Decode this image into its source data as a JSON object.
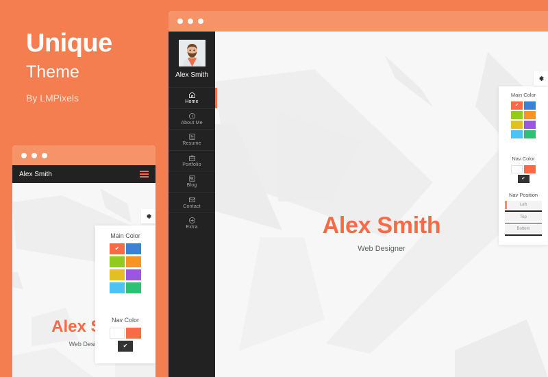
{
  "promo": {
    "title": "Unique",
    "subtitle": "Theme",
    "byline": "By LMPixels"
  },
  "colors": {
    "page_background": "#f47e4f",
    "window_bar": "#f79368",
    "sidebar": "#222222",
    "content_background": "#f7f7f7",
    "accent": "#fa6a47",
    "active_indicator": "#f4714e",
    "hero_name": "#fa6a47",
    "hero_role": "#5a5f63"
  },
  "desktop_window": {
    "titlebar_dots": 3,
    "sidebar": {
      "profile_name": "Alex Smith",
      "avatar_alt": "avatar",
      "items": [
        {
          "label": "Home",
          "icon": "home-icon",
          "active": true
        },
        {
          "label": "About Me",
          "icon": "info-icon",
          "active": false
        },
        {
          "label": "Resume",
          "icon": "resume-icon",
          "active": false
        },
        {
          "label": "Portfolio",
          "icon": "briefcase-icon",
          "active": false
        },
        {
          "label": "Blog",
          "icon": "blog-icon",
          "active": false
        },
        {
          "label": "Contact",
          "icon": "envelope-icon",
          "active": false
        },
        {
          "label": "Extra",
          "icon": "plus-icon",
          "active": false
        }
      ]
    },
    "hero": {
      "name": "Alex Smith",
      "role": "Web Designer"
    },
    "gear_button": {
      "icon": "gear-icon",
      "label": "Settings"
    },
    "settings": {
      "main_color": {
        "title": "Main Color",
        "swatches": [
          {
            "name": "red",
            "hex": "#fa6a47",
            "selected": true
          },
          {
            "name": "blue",
            "hex": "#3b82d6",
            "selected": false
          },
          {
            "name": "lime",
            "hex": "#92cb1d",
            "selected": false
          },
          {
            "name": "orange",
            "hex": "#f99321",
            "selected": false
          },
          {
            "name": "yellow",
            "hex": "#e2c024",
            "selected": false
          },
          {
            "name": "purple",
            "hex": "#9a57e0",
            "selected": false
          },
          {
            "name": "light-blue",
            "hex": "#4cc2f5",
            "selected": false
          },
          {
            "name": "green",
            "hex": "#2bc275",
            "selected": false
          }
        ]
      },
      "nav_color": {
        "title": "Nav Color",
        "swatches": [
          {
            "name": "white",
            "hex": "#ffffff",
            "selected": false
          },
          {
            "name": "orange",
            "hex": "#fa6a47",
            "selected": false
          },
          {
            "name": "dark",
            "hex": "#333333",
            "selected": true
          }
        ]
      },
      "nav_position": {
        "title": "Nav Position",
        "options": [
          {
            "label": "Left",
            "selected": true
          },
          {
            "label": "Top",
            "selected": false
          },
          {
            "label": "Bottom",
            "selected": false
          }
        ]
      },
      "check_glyph": "✔"
    }
  },
  "mobile_window": {
    "titlebar_dots": 3,
    "topbar": {
      "brand": "Alex Smith",
      "menu_icon": "hamburger-icon"
    },
    "hero": {
      "name": "Alex Sm",
      "role": "Web Desig"
    },
    "gear_button": {
      "icon": "gear-icon",
      "label": "Settings"
    },
    "settings": {
      "main_color": {
        "title": "Main Color",
        "swatches": [
          {
            "name": "red",
            "hex": "#fa6a47",
            "selected": true
          },
          {
            "name": "blue",
            "hex": "#3b82d6",
            "selected": false
          },
          {
            "name": "lime",
            "hex": "#92cb1d",
            "selected": false
          },
          {
            "name": "orange",
            "hex": "#f99321",
            "selected": false
          },
          {
            "name": "yellow",
            "hex": "#e2c024",
            "selected": false
          },
          {
            "name": "purple",
            "hex": "#9a57e0",
            "selected": false
          },
          {
            "name": "light-blue",
            "hex": "#4cc2f5",
            "selected": false
          },
          {
            "name": "green",
            "hex": "#2bc275",
            "selected": false
          }
        ]
      },
      "nav_color": {
        "title": "Nav Color",
        "swatches": [
          {
            "name": "white",
            "hex": "#ffffff",
            "selected": false
          },
          {
            "name": "orange",
            "hex": "#fa6a47",
            "selected": false
          },
          {
            "name": "dark",
            "hex": "#333333",
            "selected": true
          }
        ]
      },
      "check_glyph": "✔"
    }
  }
}
